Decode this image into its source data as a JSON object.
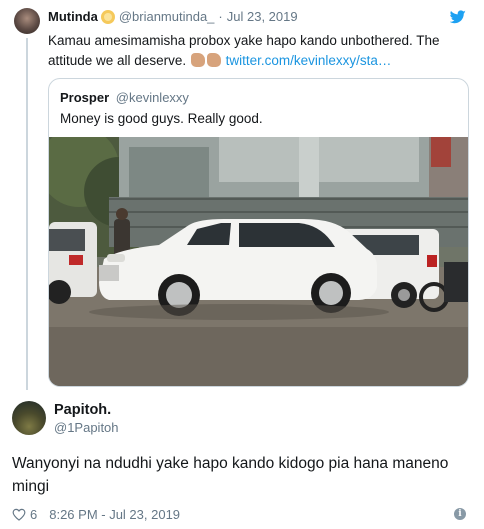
{
  "tweet": {
    "author_name": "Mutinda",
    "verified_badge_color": "#f5c95b",
    "author_handle": "@brianmutinda_",
    "separator": "·",
    "date": "Jul 23, 2019",
    "text": "Kamau amesimamisha probox yake hapo kando unbothered. The attitude we all deserve.",
    "emoji": "flexed-biceps-medium-skin-tone-x2",
    "link": "twitter.com/kevinlexxy/sta…",
    "icon": "twitter-bird-icon"
  },
  "quoted_tweet": {
    "author_name": "Prosper",
    "author_handle": "@kevinlexxy",
    "text": "Money is good guys. Really good.",
    "photo": "white luxury SUV parked on a street"
  },
  "reply": {
    "author_name": "Papitoh.",
    "author_handle": "@1Papitoh",
    "text": "Wanyonyi na ndudhi yake hapo kando kidogo pia hana maneno mingi",
    "like_count": "6",
    "timestamp": "8:26 PM - Jul 23, 2019",
    "icons": [
      "heart-icon",
      "info-icon"
    ]
  },
  "colors": {
    "link": "#1b95e0",
    "secondary_text": "#657786",
    "border": "#ccd6dd",
    "twitter_blue": "#1da1f2"
  }
}
